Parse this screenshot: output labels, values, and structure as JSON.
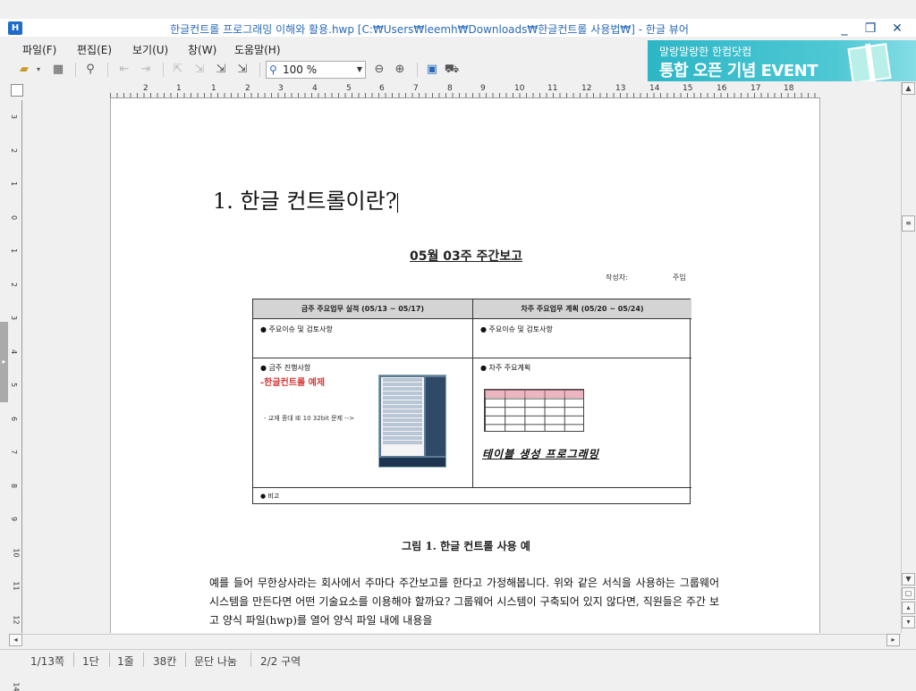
{
  "window": {
    "title": "한글컨트롤 프로그래밍 이해와 활용.hwp [C:₩Users₩leemh₩Downloads₩한글컨트롤 사용법₩] - 한글 뷰어",
    "app_icon": "hwp-icon",
    "controls": [
      "_",
      "❐",
      "✕"
    ]
  },
  "menu": {
    "items": [
      "파일(F)",
      "편집(E)",
      "보기(U)",
      "창(W)",
      "도움말(H)"
    ]
  },
  "toolbar": {
    "zoom": "100 %"
  },
  "banner": {
    "line1": "말랑말랑한 한컴닷컴",
    "line2": "통합 오픈 기념 EVENT"
  },
  "ruler": {
    "h_labels": [
      "2",
      "1",
      "1",
      "2",
      "3",
      "4",
      "5",
      "6",
      "7",
      "8",
      "9",
      "10",
      "11",
      "12",
      "13",
      "14",
      "15",
      "16",
      "17",
      "18"
    ],
    "v_labels": [
      "3",
      "2",
      "1",
      "0",
      "1",
      "2",
      "3",
      "4",
      "5",
      "6",
      "7",
      "8",
      "9",
      "10",
      "11",
      "12",
      "13",
      "14"
    ]
  },
  "document": {
    "heading": "1. 한글 컨트롤이란?",
    "report": {
      "title": "05월 03주 주간보고",
      "author_label": "작성자:",
      "author_value": "주임",
      "col1_header": "금주 주요업무 실적 (05/13 ~ 05/17)",
      "col2_header": "차주 주요업무 계획  (05/20 ~ 05/24)",
      "row1_col1": "●  주요이슈 및 검토사항",
      "row1_col2": "●  주요이슈 및 검토사항",
      "row2_col1": "●  금주 진행사항",
      "row2_col1_red": "-한글컨트롤 예제",
      "row2_col1_note": "- 교재 종대 IE 10 32bit 문제 -->",
      "row2_col2": "●  차주 주요계획",
      "row2_col2_hand": "테이블 생성 프로그래밍",
      "row3": "● 비고"
    },
    "caption": "그림 1. 한글 컨트롤 사용 예",
    "paragraph": "예를 들어 무한상사라는 회사에서 주마다 주간보고를 한다고 가정해봅니다. 위와 같은 서식을 사용하는 그룹웨어 시스템을 만든다면 어떤 기술요소를 이용해야 할까요? 그룹웨어 시스템이 구축되어 있지 않다면, 직원들은 주간 보고 양식 파일(hwp)를 열어 양식 파일 내에 내용을"
  },
  "status": {
    "page": "1/13쪽",
    "column": "1단",
    "line": "1줄",
    "char": "38칸",
    "break": "문단 나눔",
    "section": "2/2 구역"
  }
}
